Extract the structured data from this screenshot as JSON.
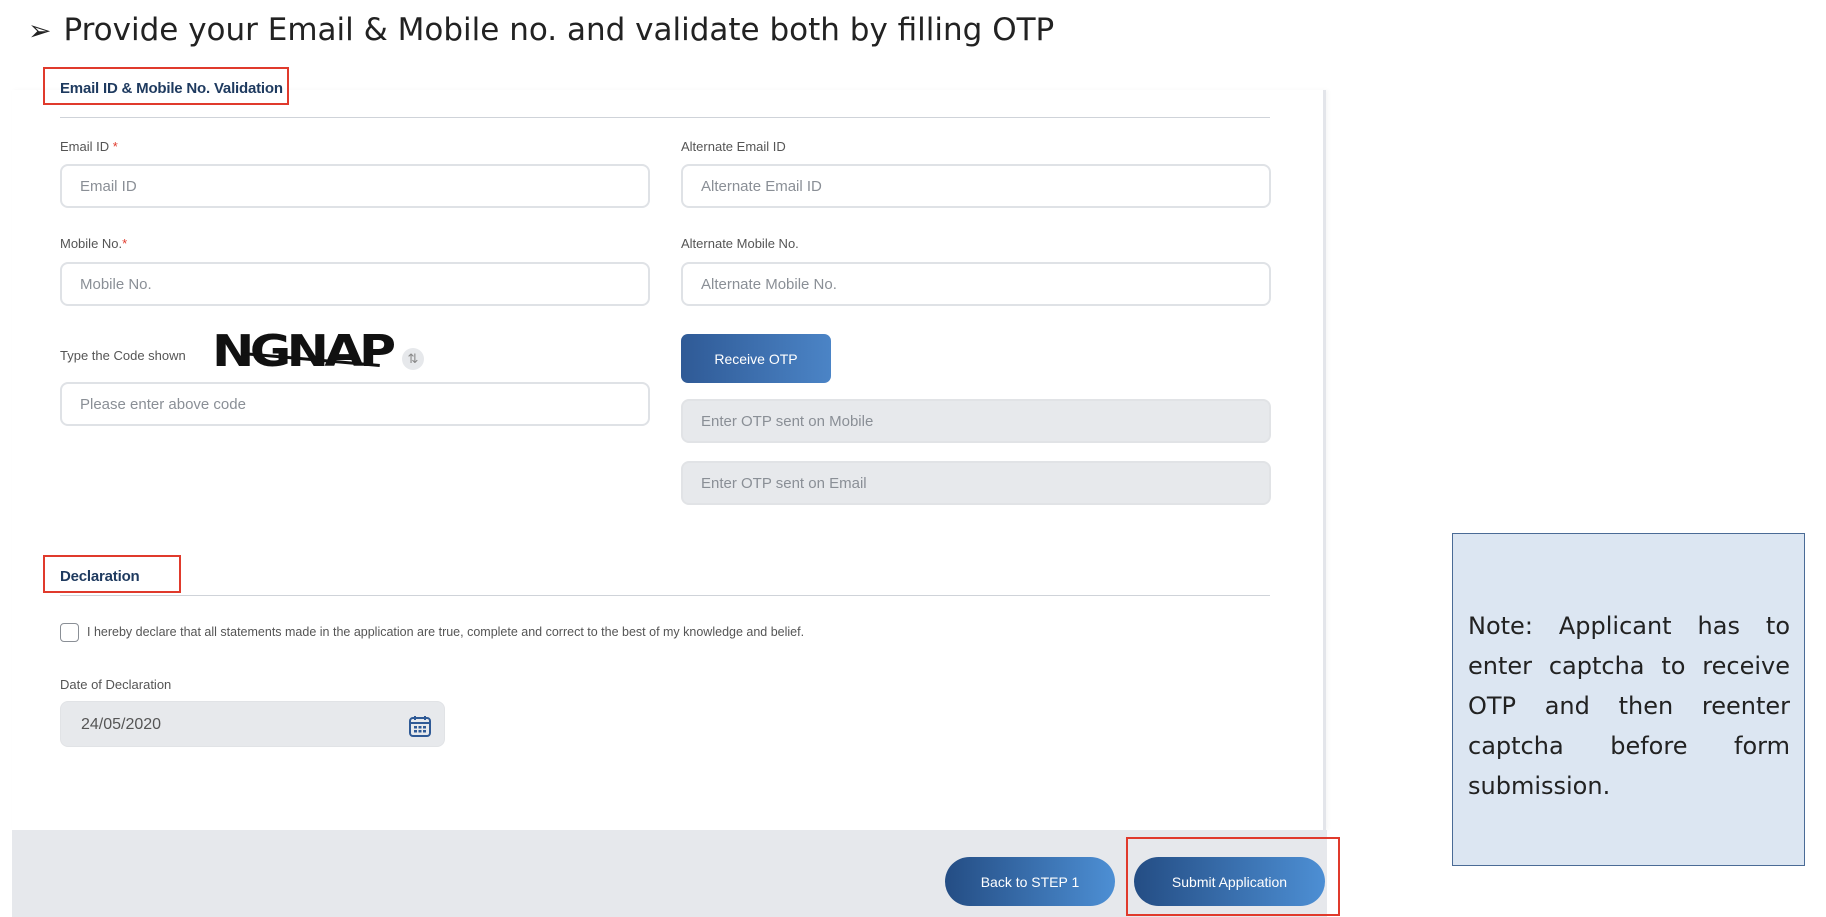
{
  "instruction": {
    "arrow": "➢",
    "text": "Provide your Email & Mobile no. and validate both by filling OTP"
  },
  "section1": {
    "title": "Email ID & Mobile No. Validation"
  },
  "fields": {
    "email": {
      "label": "Email ID",
      "required_mark": "*",
      "placeholder": "Email ID"
    },
    "alt_email": {
      "label": "Alternate Email ID",
      "placeholder": "Alternate Email ID"
    },
    "mobile": {
      "label": "Mobile No.",
      "required_mark": "*",
      "placeholder": "Mobile No."
    },
    "alt_mobile": {
      "label": "Alternate Mobile No.",
      "placeholder": "Alternate Mobile No."
    },
    "captcha": {
      "label": "Type the Code shown",
      "code": "NGNAP",
      "placeholder": "Please enter above code"
    },
    "otp_mobile": {
      "placeholder": "Enter OTP sent on Mobile"
    },
    "otp_email": {
      "placeholder": "Enter OTP sent on Email"
    }
  },
  "buttons": {
    "receive_otp": "Receive OTP",
    "back": "Back to STEP 1",
    "submit": "Submit Application"
  },
  "section2": {
    "title": "Declaration",
    "declaration_text": "I hereby declare that all statements made in the application are true, complete and correct to the best of my knowledge and belief.",
    "date_label": "Date of Declaration",
    "date_value": "24/05/2020"
  },
  "note": {
    "text": "Note: Applicant has to enter captcha to receive OTP and then reenter captcha before form submission."
  },
  "colors": {
    "highlight": "#e03a2c",
    "primary_button": "#2f5a96",
    "note_bg": "#dce6f2",
    "note_border": "#4a6b96"
  }
}
